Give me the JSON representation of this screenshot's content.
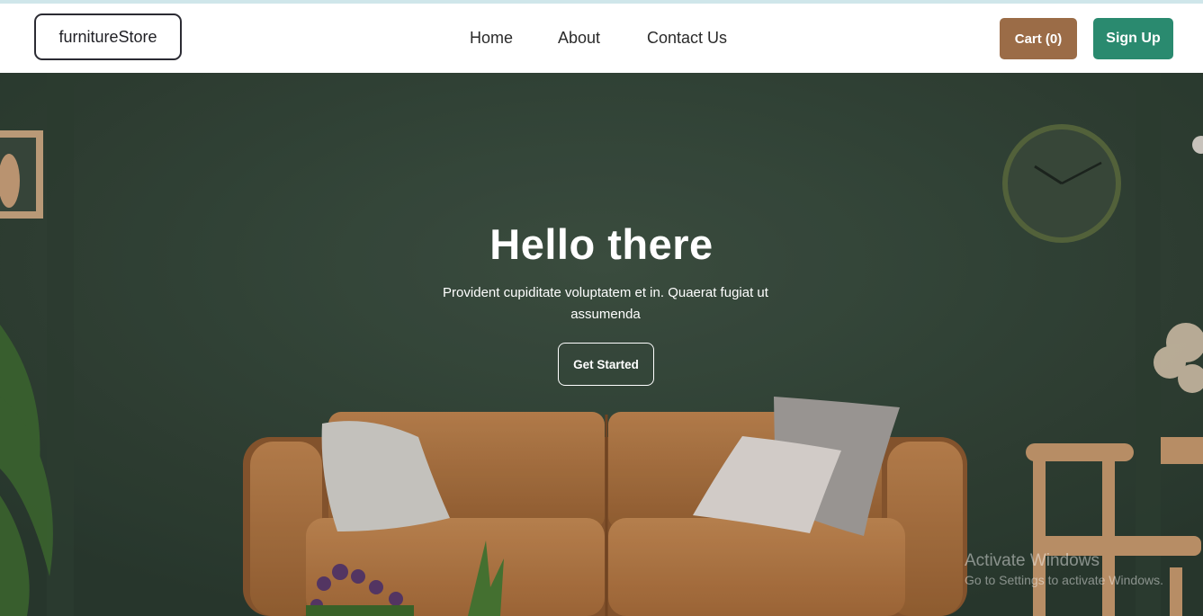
{
  "header": {
    "logo": "furnitureStore",
    "nav": [
      {
        "label": "Home"
      },
      {
        "label": "About"
      },
      {
        "label": "Contact Us"
      }
    ],
    "cart_label": "Cart (0)",
    "signup_label": "Sign Up"
  },
  "hero": {
    "title": "Hello there",
    "subtitle": "Provident cupiditate voluptatem et in. Quaerat fugiat ut assumenda",
    "cta_label": "Get Started"
  },
  "watermark": {
    "title": "Activate Windows",
    "subtitle": "Go to Settings to activate Windows."
  },
  "colors": {
    "cart_button": "#9b6c47",
    "signup_button": "#2a8a6f",
    "wall": "#34463a",
    "sofa": "#b47a44"
  }
}
